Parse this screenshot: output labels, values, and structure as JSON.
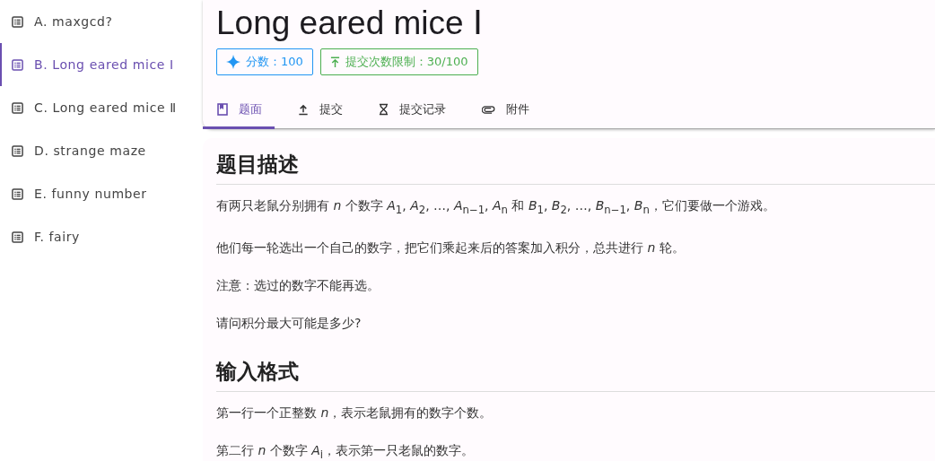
{
  "sidebar": {
    "items": [
      {
        "label": "A. maxgcd?",
        "selected": false
      },
      {
        "label": "B. Long eared mice  Ⅰ",
        "selected": true
      },
      {
        "label": "C. Long eared mice Ⅱ",
        "selected": false
      },
      {
        "label": "D. strange maze",
        "selected": false
      },
      {
        "label": "E. funny number",
        "selected": false
      },
      {
        "label": "F. fairy",
        "selected": false
      }
    ]
  },
  "problem": {
    "title": "Long eared mice  Ⅰ",
    "tags": [
      {
        "kind": "score",
        "text": "分数：100"
      },
      {
        "kind": "limit",
        "text": "提交次数限制：30/100"
      }
    ],
    "tabs": [
      {
        "label": "题面",
        "selected": true
      },
      {
        "label": "提交",
        "selected": false
      },
      {
        "label": "提交记录",
        "selected": false
      },
      {
        "label": "附件",
        "selected": false
      }
    ]
  },
  "statement": {
    "sections": [
      {
        "heading": "题目描述",
        "paragraphs": [
          "有两只老鼠分别拥有 *n* 个数字 *A*$_{1}$, *A*$_{2}$, …, *A*$_{n−1}$, *A*$_{n}$ 和 *B*$_{1}$, *B*$_{2}$, …, *B*$_{n−1}$, *B*$_{n}$，它们要做一个游戏。",
          "他们每一轮选出一个自己的数字，把它们乘起来后的答案加入积分，总共进行 *n* 轮。",
          "注意：选过的数字不能再选。",
          "请问积分最大可能是多少?"
        ]
      },
      {
        "heading": "输入格式",
        "paragraphs": [
          "第一行一个正整数 *n*，表示老鼠拥有的数字个数。",
          "第二行 *n* 个数字 *A*$_{i}$，表示第一只老鼠的数字。"
        ]
      }
    ]
  }
}
